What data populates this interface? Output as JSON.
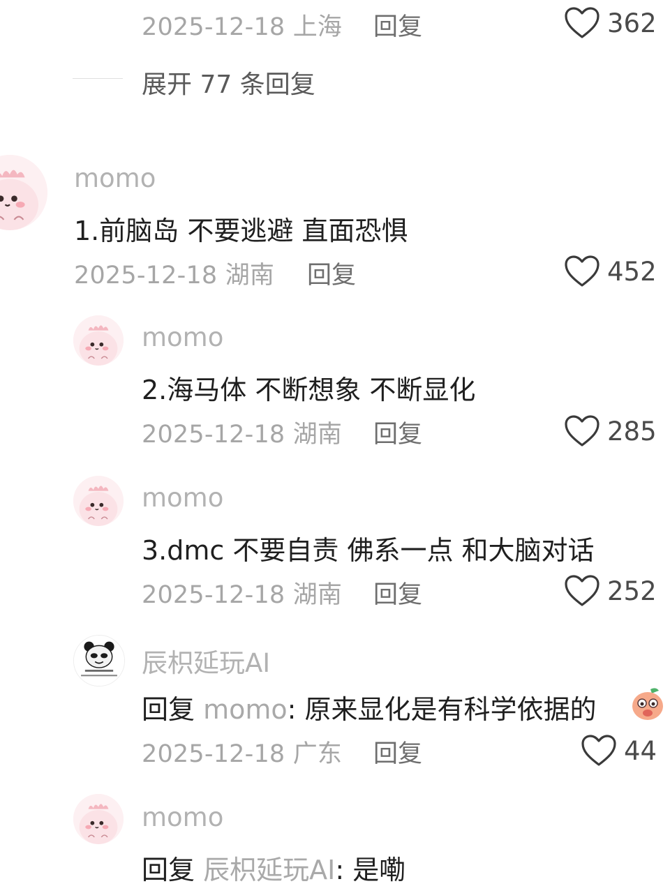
{
  "top": {
    "date": "2025-12-18",
    "location": "上海",
    "reply_label": "回复",
    "likes": "362",
    "expand_label": "展开 77 条回复"
  },
  "comments": [
    {
      "username": "momo",
      "text": "1.前脑岛 不要逃避 直面恐惧",
      "date": "2025-12-18",
      "location": "湖南",
      "reply_label": "回复",
      "likes": "452"
    },
    {
      "username": "momo",
      "text": "2.海马体 不断想象 不断显化",
      "date": "2025-12-18",
      "location": "湖南",
      "reply_label": "回复",
      "likes": "285"
    },
    {
      "username": "momo",
      "text": "3.dmc 不要自责 佛系一点 和大脑对话",
      "date": "2025-12-18",
      "location": "湖南",
      "reply_label": "回复",
      "likes": "252"
    },
    {
      "username": "辰枳延玩AI",
      "reply_prefix": "回复",
      "mention": "momo",
      "text": ": 原来显化是有科学依据的",
      "date": "2025-12-18",
      "location": "广东",
      "reply_label": "回复",
      "likes": "44"
    },
    {
      "username": "momo",
      "reply_prefix": "回复",
      "mention": "辰枳延玩AI",
      "text": ": 是嘞"
    }
  ],
  "icons": {
    "like": "heart-outline-icon",
    "avatar_momo": "pink-dino-avatar",
    "avatar_panda": "panda-meme-avatar",
    "emoji": "peach-shy-emoji"
  },
  "colors": {
    "meta": "#a6a6a6",
    "username": "#b2b2b2",
    "text": "#1f1f1f",
    "avatar_bg": "#fdf0f2"
  }
}
